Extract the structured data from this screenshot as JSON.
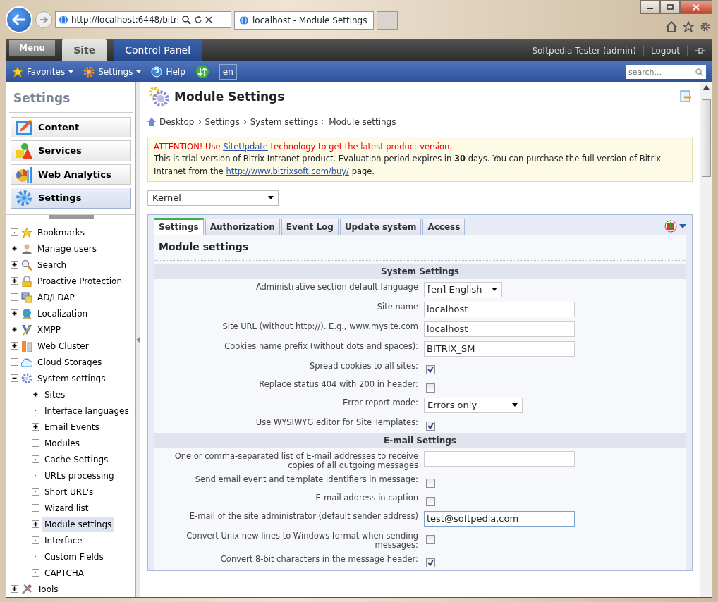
{
  "browser": {
    "address": "http://localhost:6448/bitri",
    "tab_title": "localhost - Module Settings"
  },
  "admin_bar": {
    "menu": "Menu",
    "tabs": [
      {
        "label": "Site",
        "selected": false
      },
      {
        "label": "Control Panel",
        "selected": true
      }
    ],
    "user": "Softpedia Tester (admin)",
    "logout": "Logout"
  },
  "toolbar": {
    "items": [
      {
        "label": "Favorites",
        "kind": "menu"
      },
      {
        "label": "Settings",
        "kind": "menu"
      },
      {
        "label": "Help",
        "kind": "link"
      }
    ],
    "language": "en",
    "search": {
      "placeholder": "search..."
    }
  },
  "sidebar": {
    "title": "Settings",
    "sections": [
      {
        "label": "Content",
        "selected": false
      },
      {
        "label": "Services",
        "selected": false
      },
      {
        "label": "Web Analytics",
        "selected": false
      },
      {
        "label": "Settings",
        "selected": true
      }
    ],
    "tree": [
      {
        "label": "Bookmarks",
        "expandable": false,
        "selected": false
      },
      {
        "label": "Manage users",
        "expandable": true,
        "expanded": false,
        "selected": false
      },
      {
        "label": "Search",
        "expandable": true,
        "expanded": false,
        "selected": false
      },
      {
        "label": "Proactive Protection",
        "expandable": true,
        "expanded": false,
        "selected": false
      },
      {
        "label": "AD/LDAP",
        "expandable": false,
        "selected": false
      },
      {
        "label": "Localization",
        "expandable": true,
        "expanded": false,
        "selected": false
      },
      {
        "label": "XMPP",
        "expandable": true,
        "expanded": false,
        "selected": false
      },
      {
        "label": "Web Cluster",
        "expandable": true,
        "expanded": false,
        "selected": false
      },
      {
        "label": "Cloud Storages",
        "expandable": false,
        "selected": false
      },
      {
        "label": "System settings",
        "expandable": true,
        "expanded": true,
        "selected": false,
        "children": [
          {
            "label": "Sites",
            "expandable": true,
            "expanded": false,
            "selected": false
          },
          {
            "label": "Interface languages",
            "expandable": false,
            "selected": false
          },
          {
            "label": "Email Events",
            "expandable": true,
            "expanded": false,
            "selected": false
          },
          {
            "label": "Modules",
            "expandable": false,
            "selected": false
          },
          {
            "label": "Cache Settings",
            "expandable": false,
            "selected": false
          },
          {
            "label": "URLs processing",
            "expandable": false,
            "selected": false
          },
          {
            "label": "Short URL's",
            "expandable": false,
            "selected": false
          },
          {
            "label": "Wizard list",
            "expandable": false,
            "selected": false
          },
          {
            "label": "Module settings",
            "expandable": true,
            "expanded": false,
            "selected": true
          },
          {
            "label": "Interface",
            "expandable": false,
            "selected": false
          },
          {
            "label": "Custom Fields",
            "expandable": false,
            "selected": false
          },
          {
            "label": "CAPTCHA",
            "expandable": false,
            "selected": false
          }
        ]
      },
      {
        "label": "Tools",
        "expandable": true,
        "expanded": false,
        "selected": false
      }
    ]
  },
  "page": {
    "title": "Module Settings",
    "breadcrumb": [
      "Desktop",
      "Settings",
      "System settings",
      "Module settings"
    ],
    "notice": {
      "attention_before": "ATTENTION! Use ",
      "attention_link": "SiteUpdate",
      "attention_after": " technology to get the latest product version.",
      "trial_before": "This is trial version of Bitrix Intranet product. Evaluation period expires in **30** days. You can purchase the full version of Bitrix Intranet from the ",
      "trial_link": "http://www.bitrixsoft.com/buy/",
      "trial_after": " page."
    },
    "module_select": "Kernel",
    "tabs": [
      {
        "label": "Settings",
        "selected": true
      },
      {
        "label": "Authorization",
        "selected": false
      },
      {
        "label": "Event Log",
        "selected": false
      },
      {
        "label": "Update system",
        "selected": false
      },
      {
        "label": "Access",
        "selected": false
      }
    ],
    "form_title": "Module settings",
    "sections": [
      {
        "heading": "System Settings",
        "fields": [
          {
            "kind": "select",
            "label": "Administrative section default language",
            "value": "[en] English"
          },
          {
            "kind": "text",
            "label": "Site name",
            "value": "localhost",
            "focused": false
          },
          {
            "kind": "text",
            "label": "Site URL (without http://). E.g., www.mysite.com",
            "value": "localhost",
            "focused": false
          },
          {
            "kind": "text",
            "label": "Cookies name prefix (without dots and spaces):",
            "value": "BITRIX_SM",
            "focused": false
          },
          {
            "kind": "checkbox",
            "label": "Spread cookies to all sites:",
            "checked": true
          },
          {
            "kind": "checkbox",
            "label": "Replace status 404 with 200 in header:",
            "checked": false
          },
          {
            "kind": "select",
            "label": "Error report mode:",
            "value": "Errors only"
          },
          {
            "kind": "checkbox",
            "label": "Use WYSIWYG editor for Site Templates:",
            "checked": true
          }
        ]
      },
      {
        "heading": "E-mail Settings",
        "fields": [
          {
            "kind": "text",
            "label": "One or comma-separated list of E-mail addresses to receive copies of all outgoing messages",
            "focused": false
          },
          {
            "kind": "checkbox",
            "label": "Send email event and template identifiers in message:",
            "checked": false
          },
          {
            "kind": "checkbox",
            "label": "E-mail address in caption",
            "checked": false
          },
          {
            "kind": "text",
            "label": "E-mail of the site administrator (default sender address)",
            "value": "test@softpedia.com",
            "focused": true
          },
          {
            "kind": "checkbox",
            "label": "Convert Unix new lines to Windows format when sending messages:",
            "checked": false
          },
          {
            "kind": "checkbox",
            "label": "Convert 8-bit characters in the message header:",
            "checked": true
          }
        ]
      }
    ]
  }
}
